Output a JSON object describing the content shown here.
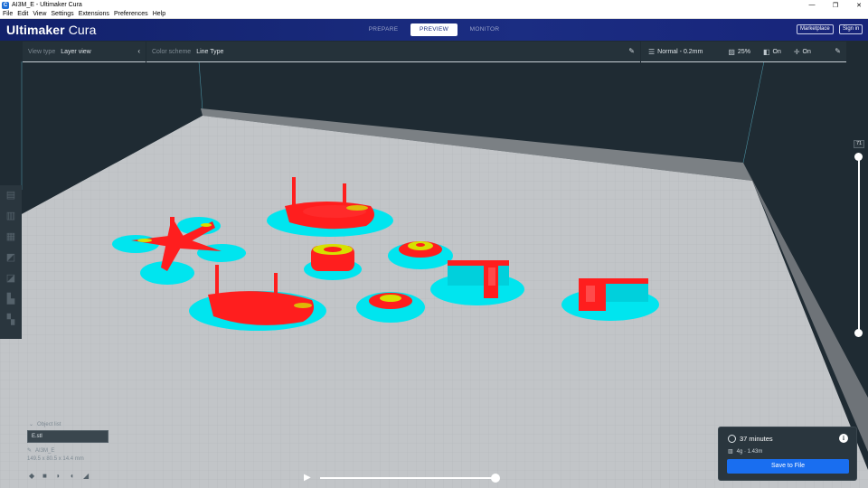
{
  "window": {
    "title": "AI3M_E - Ultimaker Cura",
    "controls": [
      "—",
      "❐",
      "✕"
    ]
  },
  "menu": [
    "File",
    "Edit",
    "View",
    "Settings",
    "Extensions",
    "Preferences",
    "Help"
  ],
  "header": {
    "brand_bold": "Ultimaker",
    "brand_light": " Cura",
    "stages": [
      "PREPARE",
      "PREVIEW",
      "MONITOR"
    ],
    "active_stage": "PREVIEW",
    "marketplace_label": "Marketplace",
    "signin_label": "Sign in",
    "background_color": "#1b2d82"
  },
  "toolbar": {
    "view_type_label": "View type",
    "view_type_value": "Layer view",
    "color_scheme_label": "Color scheme",
    "color_scheme_value": "Line Type",
    "profile": "Normal - 0.2mm",
    "infill": "25%",
    "support": "On",
    "adhesion": "On"
  },
  "left_tools": [
    "open-icon",
    "move-icon",
    "scale-icon",
    "rotate-icon",
    "mirror-icon",
    "per-model-settings-icon",
    "support-blocker-icon"
  ],
  "layer_slider": {
    "current_layer": "71",
    "position_fraction": 1.0
  },
  "object_list": {
    "header": "Object list",
    "file": "E.stl",
    "job_name": "AI3M_E",
    "dimensions": "149.5 x 80.5 x 14.4 mm"
  },
  "simulation": {
    "play_symbol": "▶",
    "progress_fraction": 1.0
  },
  "estimate": {
    "time": "37 minutes",
    "material": "4g · 1.43m",
    "info_symbol": "i",
    "save_label": "Save to File",
    "save_color": "#196ef0"
  },
  "scene_colors": {
    "background": "#1f2b33",
    "bed": "#c2c5c8",
    "wall": "#7b8084",
    "skirt": "#00e5ef",
    "wall_fill": "#ff1e1e",
    "top_skin": "#d6e000"
  }
}
